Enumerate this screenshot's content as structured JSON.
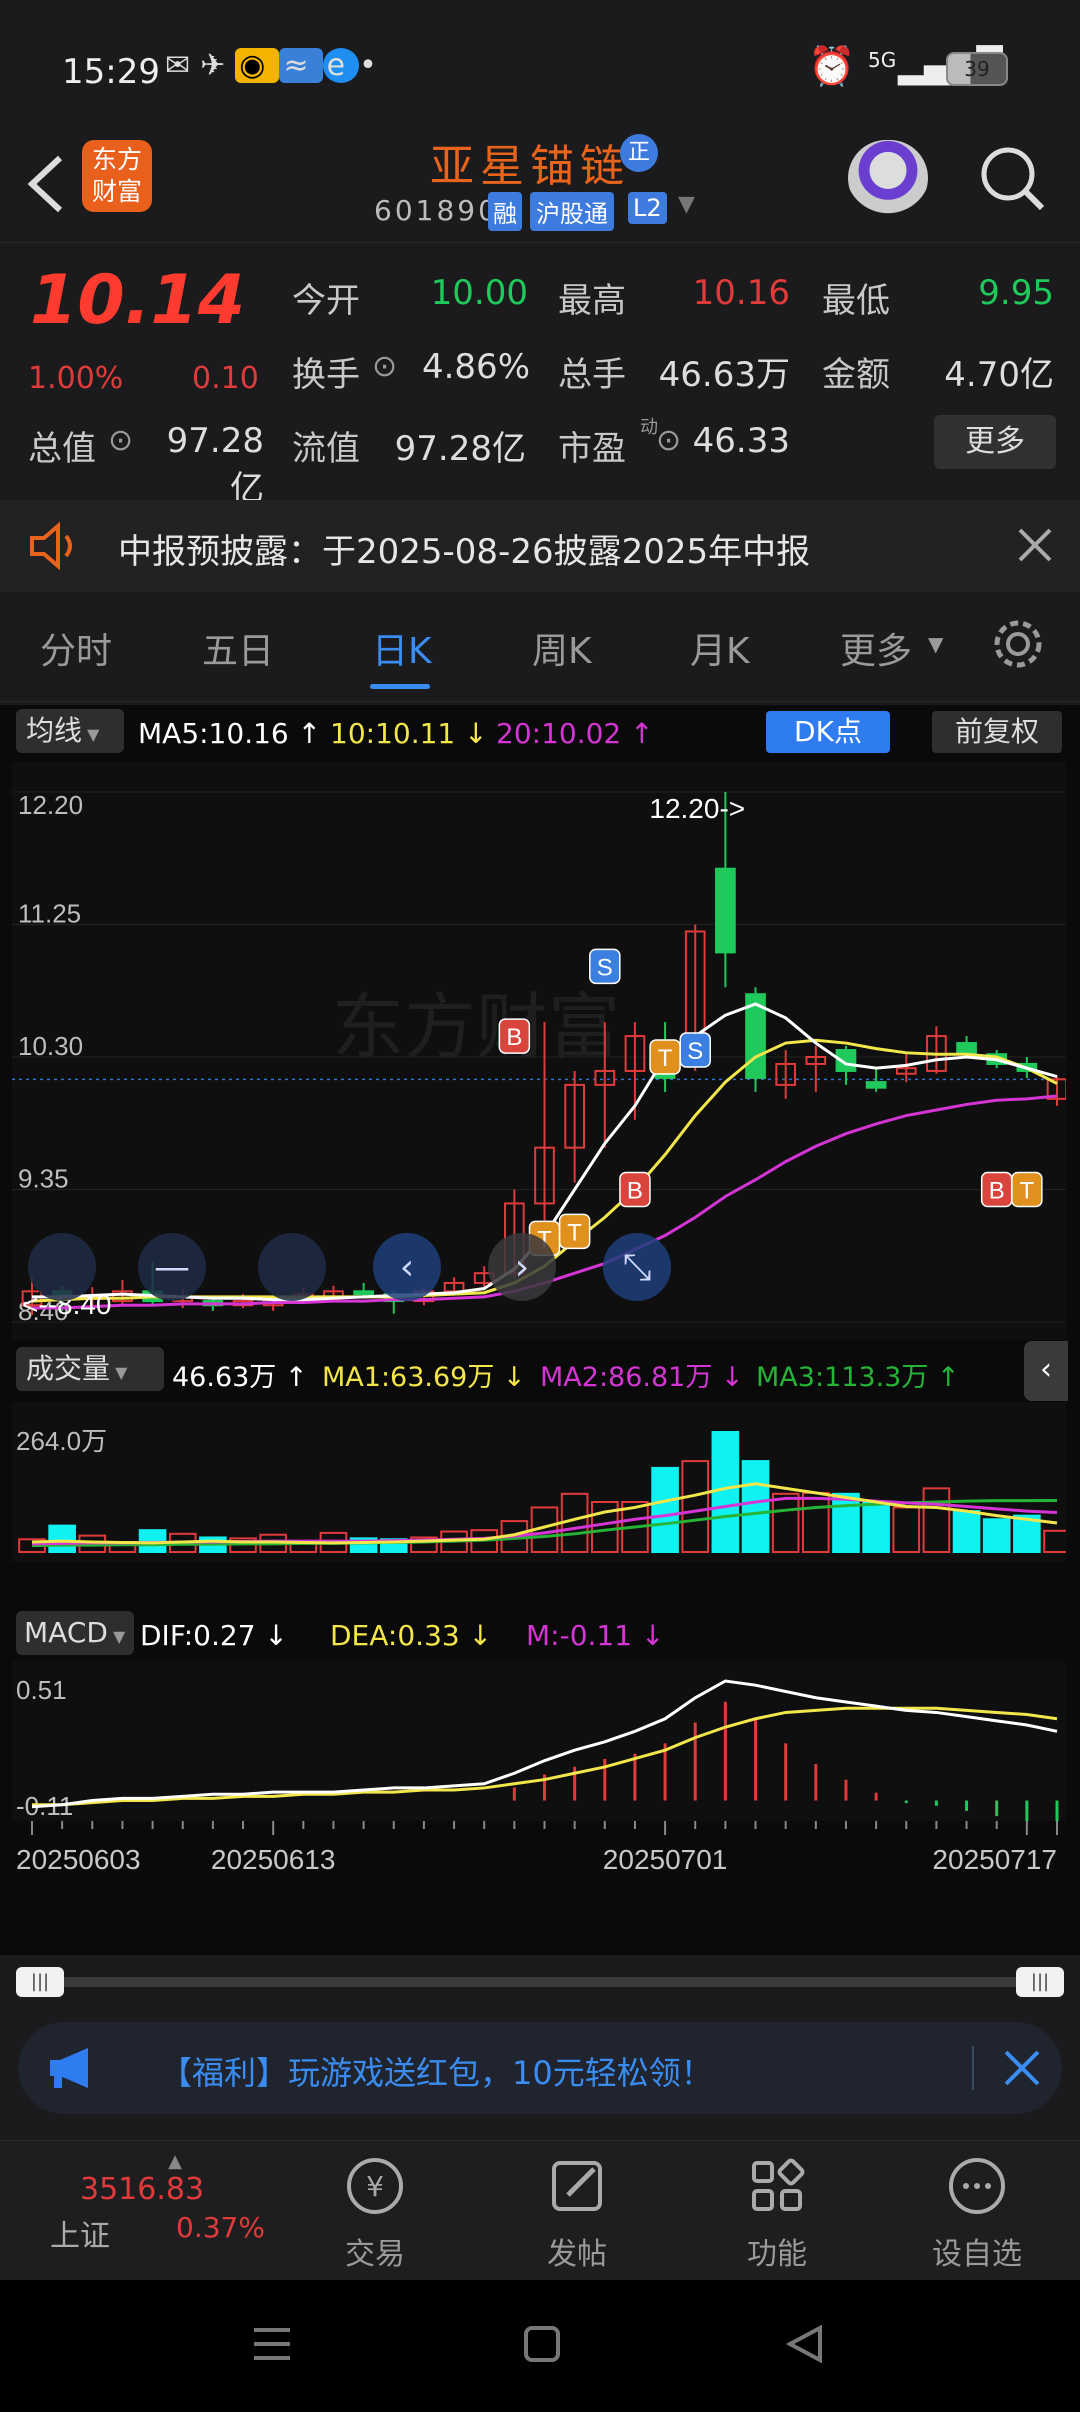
{
  "status": {
    "time": "15:29",
    "signal": "5G",
    "battery": "39"
  },
  "header": {
    "app_logo_line1": "东方",
    "app_logo_line2": "财富",
    "stock_name": "亚星锚链",
    "stock_badge": "正",
    "stock_code": "601890",
    "tags": [
      "融",
      "沪股通",
      "L2"
    ]
  },
  "quote": {
    "price": "10.14",
    "change_pct": "1.00%",
    "change": "0.10",
    "open_label": "今开",
    "open": "10.00",
    "high_label": "最高",
    "high": "10.16",
    "low_label": "最低",
    "low": "9.95",
    "turnover_label": "换手",
    "turnover": "4.86%",
    "volume_label": "总手",
    "volume": "46.63万",
    "amount_label": "金额",
    "amount": "4.70亿",
    "mktcap_label": "总值",
    "mktcap": "97.28亿",
    "float_label": "流值",
    "float": "97.28亿",
    "pe_label": "市盈",
    "pe_sup": "动",
    "pe": "46.33",
    "more": "更多"
  },
  "notice": {
    "text": "中报预披露：于2025-08-26披露2025年中报"
  },
  "tabs": [
    "分时",
    "五日",
    "日K",
    "周K",
    "月K",
    "更多"
  ],
  "active_tab": "日K",
  "chart_controls": {
    "indicator": "均线",
    "ma5": "MA5:10.16",
    "ma10": "10:10.11",
    "ma20": "20:10.02",
    "dk_button": "DK点",
    "fq_button": "前复权"
  },
  "volume_legend": {
    "label": "成交量",
    "vol": "46.63万",
    "ma1": "MA1:63.69万",
    "ma2": "MA2:86.81万",
    "ma3": "MA3:113.3万"
  },
  "macd_legend": {
    "label": "MACD",
    "dif": "DIF:0.27",
    "dea": "DEA:0.33",
    "m": "M:-0.11"
  },
  "chart_data": [
    {
      "type": "candlestick",
      "y_ticks": [
        "12.20",
        "11.25",
        "10.30",
        "9.35",
        "8.40"
      ],
      "ylim": [
        8.4,
        12.2
      ],
      "annotations": [
        "12.20->",
        "<--8.40"
      ],
      "signals": [
        "B",
        "T",
        "T",
        "S",
        "B",
        "T",
        "S",
        "B",
        "T"
      ],
      "x_ticks": [
        "20250603",
        "20250613",
        "20250701",
        "20250717"
      ],
      "candles": [
        {
          "o": 8.52,
          "c": 8.62,
          "h": 8.72,
          "l": 8.45
        },
        {
          "o": 8.62,
          "c": 8.56,
          "h": 8.66,
          "l": 8.48
        },
        {
          "o": 8.58,
          "c": 8.58,
          "h": 8.65,
          "l": 8.5
        },
        {
          "o": 8.55,
          "c": 8.62,
          "h": 8.7,
          "l": 8.52
        },
        {
          "o": 8.62,
          "c": 8.55,
          "h": 8.83,
          "l": 8.52
        },
        {
          "o": 8.55,
          "c": 8.58,
          "h": 8.64,
          "l": 8.5
        },
        {
          "o": 8.55,
          "c": 8.52,
          "h": 8.58,
          "l": 8.48
        },
        {
          "o": 8.52,
          "c": 8.55,
          "h": 8.6,
          "l": 8.5
        },
        {
          "o": 8.52,
          "c": 8.56,
          "h": 8.58,
          "l": 8.48
        },
        {
          "o": 8.56,
          "c": 8.6,
          "h": 8.65,
          "l": 8.54
        },
        {
          "o": 8.58,
          "c": 8.62,
          "h": 8.66,
          "l": 8.56
        },
        {
          "o": 8.62,
          "c": 8.6,
          "h": 8.68,
          "l": 8.58
        },
        {
          "o": 8.6,
          "c": 8.55,
          "h": 8.62,
          "l": 8.46
        },
        {
          "o": 8.55,
          "c": 8.62,
          "h": 8.65,
          "l": 8.52
        },
        {
          "o": 8.62,
          "c": 8.68,
          "h": 8.72,
          "l": 8.6
        },
        {
          "o": 8.68,
          "c": 8.75,
          "h": 8.8,
          "l": 8.65
        },
        {
          "o": 8.75,
          "c": 9.25,
          "h": 9.35,
          "l": 8.72
        },
        {
          "o": 9.25,
          "c": 9.65,
          "h": 10.55,
          "l": 9.05
        },
        {
          "o": 9.65,
          "c": 10.1,
          "h": 10.2,
          "l": 9.4
        },
        {
          "o": 10.1,
          "c": 10.2,
          "h": 10.55,
          "l": 9.65
        },
        {
          "o": 10.2,
          "c": 10.45,
          "h": 10.55,
          "l": 9.85
        },
        {
          "o": 10.35,
          "c": 10.15,
          "h": 10.55,
          "l": 10.05
        },
        {
          "o": 10.45,
          "c": 11.2,
          "h": 11.25,
          "l": 10.2
        },
        {
          "o": 11.65,
          "c": 11.05,
          "h": 12.2,
          "l": 10.8
        },
        {
          "o": 10.75,
          "c": 10.15,
          "h": 10.8,
          "l": 10.05
        },
        {
          "o": 10.1,
          "c": 10.25,
          "h": 10.35,
          "l": 10.0
        },
        {
          "o": 10.25,
          "c": 10.3,
          "h": 10.38,
          "l": 10.05
        },
        {
          "o": 10.35,
          "c": 10.2,
          "h": 10.38,
          "l": 10.1
        },
        {
          "o": 10.12,
          "c": 10.08,
          "h": 10.22,
          "l": 10.05
        },
        {
          "o": 10.18,
          "c": 10.22,
          "h": 10.32,
          "l": 10.12
        },
        {
          "o": 10.2,
          "c": 10.45,
          "h": 10.52,
          "l": 10.18
        },
        {
          "o": 10.4,
          "c": 10.32,
          "h": 10.45,
          "l": 10.3
        },
        {
          "o": 10.32,
          "c": 10.25,
          "h": 10.35,
          "l": 10.22
        },
        {
          "o": 10.25,
          "c": 10.2,
          "h": 10.3,
          "l": 10.15
        },
        {
          "o": 10.0,
          "c": 10.14,
          "h": 10.16,
          "l": 9.95
        }
      ],
      "ma5": [
        8.58,
        8.58,
        8.59,
        8.6,
        8.59,
        8.58,
        8.57,
        8.57,
        8.56,
        8.56,
        8.57,
        8.58,
        8.59,
        8.6,
        8.61,
        8.64,
        8.78,
        9.02,
        9.35,
        9.68,
        9.95,
        10.3,
        10.45,
        10.6,
        10.68,
        10.58,
        10.4,
        10.25,
        10.22,
        10.24,
        10.28,
        10.3,
        10.28,
        10.22,
        10.16
      ],
      "ma10": [
        8.55,
        8.56,
        8.57,
        8.57,
        8.58,
        8.58,
        8.58,
        8.58,
        8.58,
        8.58,
        8.58,
        8.58,
        8.58,
        8.59,
        8.6,
        8.61,
        8.68,
        8.8,
        8.98,
        9.15,
        9.35,
        9.6,
        9.88,
        10.12,
        10.3,
        10.4,
        10.42,
        10.4,
        10.36,
        10.33,
        10.32,
        10.32,
        10.3,
        10.22,
        10.11
      ],
      "ma20": [
        8.5,
        8.5,
        8.51,
        8.52,
        8.52,
        8.53,
        8.53,
        8.53,
        8.54,
        8.54,
        8.55,
        8.55,
        8.56,
        8.56,
        8.57,
        8.58,
        8.62,
        8.68,
        8.75,
        8.82,
        8.92,
        9.02,
        9.15,
        9.3,
        9.42,
        9.55,
        9.66,
        9.75,
        9.82,
        9.88,
        9.92,
        9.96,
        9.99,
        10.0,
        10.02
      ]
    },
    {
      "type": "bar",
      "name": "volume",
      "y_ticks": [
        "264.0万"
      ],
      "ylim": [
        0,
        264
      ],
      "values": [
        28,
        58,
        36,
        22,
        48,
        40,
        32,
        30,
        38,
        22,
        42,
        30,
        28,
        32,
        45,
        48,
        68,
        98,
        128,
        110,
        110,
        185,
        200,
        264,
        200,
        128,
        130,
        128,
        110,
        98,
        140,
        90,
        72,
        80,
        46.63
      ],
      "ma1": [
        22,
        24,
        22,
        21,
        20,
        22,
        24,
        22,
        22,
        21,
        20,
        21,
        22,
        24,
        26,
        28,
        38,
        55,
        72,
        88,
        98,
        112,
        125,
        140,
        150,
        140,
        130,
        120,
        110,
        100,
        98,
        90,
        80,
        72,
        63.69
      ],
      "ma2": [
        18,
        19,
        20,
        20,
        21,
        22,
        22,
        23,
        24,
        24,
        24,
        24,
        25,
        26,
        28,
        30,
        35,
        42,
        52,
        62,
        72,
        80,
        90,
        100,
        110,
        118,
        118,
        116,
        112,
        108,
        105,
        100,
        95,
        90,
        86.81
      ],
      "ma3": [
        14,
        15,
        15,
        16,
        16,
        17,
        17,
        18,
        18,
        19,
        19,
        20,
        21,
        22,
        24,
        26,
        30,
        34,
        40,
        48,
        55,
        62,
        70,
        78,
        85,
        92,
        98,
        102,
        105,
        108,
        110,
        112,
        113,
        113,
        113.3
      ]
    },
    {
      "type": "bar",
      "name": "MACD",
      "y_ticks": [
        "0.51",
        "-0.11"
      ],
      "ylim": [
        -0.11,
        0.51
      ],
      "dif": [
        -0.09,
        -0.08,
        -0.06,
        -0.05,
        -0.05,
        -0.04,
        -0.03,
        -0.03,
        -0.02,
        -0.02,
        -0.02,
        -0.01,
        0.0,
        0.0,
        0.01,
        0.02,
        0.07,
        0.13,
        0.18,
        0.22,
        0.27,
        0.33,
        0.43,
        0.51,
        0.49,
        0.46,
        0.43,
        0.41,
        0.39,
        0.37,
        0.36,
        0.34,
        0.32,
        0.3,
        0.27
      ],
      "dea": [
        -0.08,
        -0.08,
        -0.07,
        -0.06,
        -0.06,
        -0.05,
        -0.05,
        -0.04,
        -0.04,
        -0.03,
        -0.03,
        -0.02,
        -0.02,
        -0.01,
        -0.01,
        0.0,
        0.02,
        0.04,
        0.07,
        0.1,
        0.14,
        0.18,
        0.24,
        0.29,
        0.33,
        0.36,
        0.37,
        0.38,
        0.38,
        0.38,
        0.38,
        0.37,
        0.36,
        0.35,
        0.33
      ],
      "hist": [
        0.0,
        0.0,
        0.0,
        0.0,
        0.0,
        0.0,
        0.0,
        0.0,
        0.0,
        0.0,
        0.0,
        0.0,
        0.0,
        0.0,
        0.0,
        0.0,
        0.05,
        0.1,
        0.13,
        0.16,
        0.18,
        0.22,
        0.3,
        0.38,
        0.32,
        0.22,
        0.14,
        0.08,
        0.03,
        -0.01,
        -0.02,
        -0.04,
        -0.06,
        -0.08,
        -0.11
      ]
    }
  ],
  "range_slider": {
    "left_handle": "|||",
    "right_handle": "|||"
  },
  "banner": {
    "text": "【福利】玩游戏送红包，10元轻松领！"
  },
  "bottom_nav": {
    "index_value": "3516.83",
    "index_name": "上证",
    "index_change": "0.37%",
    "trade": "交易",
    "post": "发帖",
    "func": "功能",
    "add": "设自选"
  },
  "colors": {
    "up": "#e03a3a",
    "down": "#1fc95b",
    "white": "#ffffff",
    "ma10": "#f2e64a",
    "ma20": "#d535d5",
    "cyan": "#10f2f2",
    "accent": "#2f7cf0"
  }
}
